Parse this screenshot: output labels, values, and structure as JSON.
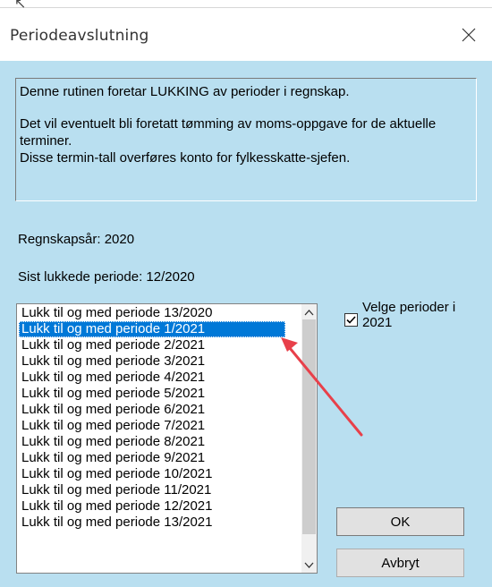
{
  "window": {
    "cursor_glyph": "↖",
    "title": "Periodeavslutning",
    "close_glyph": "✕"
  },
  "info": {
    "line1": "Denne rutinen foretar LUKKING av perioder i regnskap.",
    "line2": "Det vil eventuelt bli foretatt tømming av moms-oppgave for de aktuelle terminer.",
    "line3": "Disse termin-tall overføres konto for fylkesskatte-sjefen."
  },
  "fiscal_year": {
    "text": "Regnskapsår:  2020"
  },
  "last_closed": {
    "text": "Sist lukkede periode:  12/2020"
  },
  "periods": {
    "items": [
      "Lukk til og med periode 13/2020",
      "Lukk til og med periode  1/2021",
      "Lukk til og med periode  2/2021",
      "Lukk til og med periode  3/2021",
      "Lukk til og med periode  4/2021",
      "Lukk til og med periode  5/2021",
      "Lukk til og med periode  6/2021",
      "Lukk til og med periode  7/2021",
      "Lukk til og med periode  8/2021",
      "Lukk til og med periode  9/2021",
      "Lukk til og med periode 10/2021",
      "Lukk til og med periode 11/2021",
      "Lukk til og med periode 12/2021",
      "Lukk til og med periode 13/2021"
    ],
    "selected_index": 1
  },
  "select_periods": {
    "label": "Velge perioder i 2021",
    "checked": true
  },
  "buttons": {
    "ok": "OK",
    "cancel": "Avbryt"
  },
  "annotation": {
    "arrow_color": "#e8404a"
  }
}
